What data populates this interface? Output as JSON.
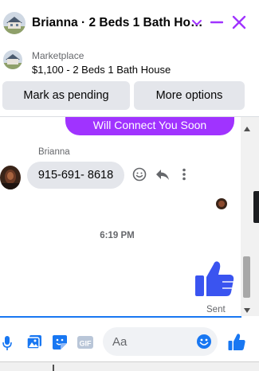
{
  "colors": {
    "accent": "#a033ff",
    "messenger_blue": "#1877f2",
    "like_blue": "#3a54f0",
    "bubble_gray": "#e4e6eb",
    "secondary_text": "#65676b"
  },
  "header": {
    "title": "Brianna · 2 Beds 1 Bath Ho…",
    "icons": [
      "house-thumbnail",
      "chevron-down-icon",
      "minimize-icon",
      "close-icon"
    ]
  },
  "listing": {
    "label": "Marketplace",
    "title": "$1,100 - 2 Beds 1 Bath House",
    "mark_pending_label": "Mark as pending",
    "more_options_label": "More options"
  },
  "chat": {
    "previous_message": "Will Connect You Soon",
    "sender_name": "Brianna",
    "incoming_message": "915-691- 8618",
    "timestamp": "6:19 PM",
    "outgoing_sticker": "thumbs-up-icon",
    "status": "Sent"
  },
  "composer": {
    "placeholder": "Aa",
    "icons": [
      "microphone-icon",
      "photo-icon",
      "sticker-icon",
      "gif-icon",
      "emoji-icon",
      "like-icon"
    ],
    "gif_label": "GIF"
  }
}
